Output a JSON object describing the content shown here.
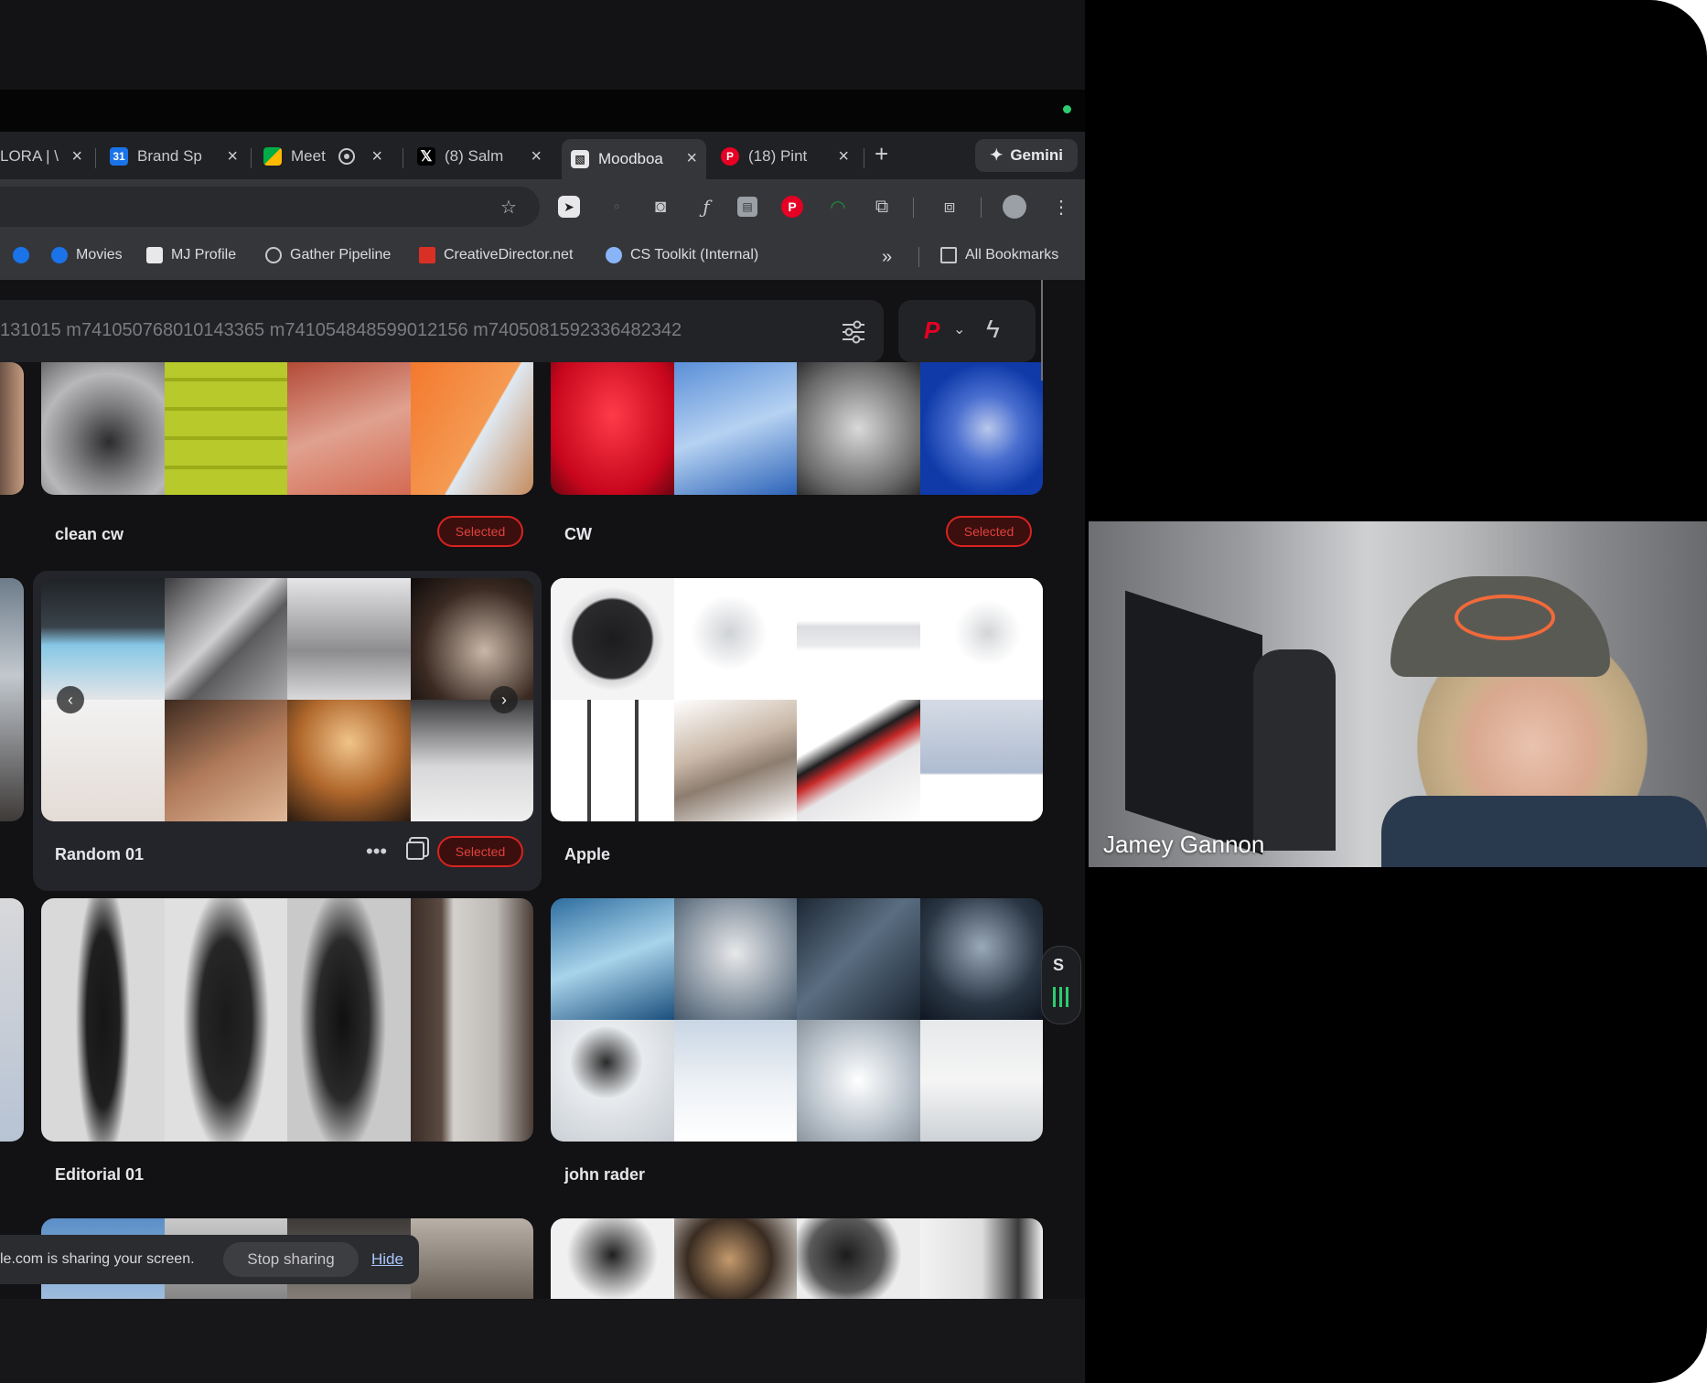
{
  "tabs": [
    {
      "label": "LORA | \\",
      "icon": "lora-tab-icon"
    },
    {
      "label": "Brand Sp",
      "icon": "calendar-tab-icon"
    },
    {
      "label": "Meet",
      "icon": "meet-tab-icon"
    },
    {
      "label": "(8) Salm",
      "icon": "x-tab-icon"
    },
    {
      "label": "Moodboa",
      "icon": "moodboard-tab-icon",
      "active": true
    },
    {
      "label": "(18) Pint",
      "icon": "pinterest-tab-icon"
    }
  ],
  "gemini_label": "Gemini",
  "new_tab_label": "+",
  "bookmarks": {
    "items": [
      "Movies",
      "MJ Profile",
      "Gather Pipeline",
      "CreativeDirector.net",
      "CS Toolkit (Internal)"
    ],
    "overflow": "»",
    "all_bookmarks": "All Bookmarks"
  },
  "search": {
    "query": "131015 m741050768010143365 m741054848599012156 m740508159233648234​2",
    "mode_label": "P"
  },
  "cards": [
    {
      "name": "clean cw",
      "selected_label": "Selected"
    },
    {
      "name": "CW",
      "selected_label": "Selected"
    },
    {
      "name": "Random 01",
      "selected_label": "Selected"
    },
    {
      "name": "Apple"
    },
    {
      "name": "Editorial 01"
    },
    {
      "name": "john rader"
    }
  ],
  "side_widget_label": "S",
  "share_banner": {
    "text": "le.com is sharing your screen.",
    "stop": "Stop sharing",
    "hide": "Hide"
  },
  "video": {
    "participant": "Jamey Gannon"
  },
  "colors": {
    "accent_red": "#d9231f",
    "pinterest_red": "#e60023",
    "link_blue": "#a8c7fa"
  }
}
